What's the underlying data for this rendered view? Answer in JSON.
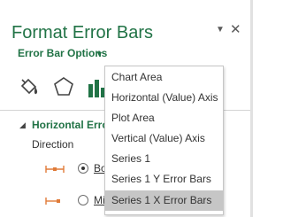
{
  "pane": {
    "title": "Format Error Bars",
    "options_label": "Error Bar Options"
  },
  "icons": {
    "pin_dropdown": "▼",
    "close": "✕",
    "options_dropdown": "▼",
    "fill": "fill-line-icon",
    "effects": "effects-pentagon-icon",
    "options": "bar-chart-options-icon"
  },
  "section": {
    "expander": "◢",
    "heading": "Horizontal Erro",
    "direction_label": "Direction",
    "radios": [
      {
        "label": "Bo",
        "checked": true
      },
      {
        "label": "Mi",
        "checked": false
      }
    ]
  },
  "dropdown": {
    "items": [
      {
        "label": "Chart Area",
        "selected": false
      },
      {
        "label": "Horizontal (Value) Axis",
        "selected": false
      },
      {
        "label": "Plot Area",
        "selected": false
      },
      {
        "label": "Vertical (Value) Axis",
        "selected": false
      },
      {
        "label": "Series 1",
        "selected": false
      },
      {
        "label": "Series 1 Y Error Bars",
        "selected": false
      },
      {
        "label": "Series 1 X Error Bars",
        "selected": true
      }
    ]
  },
  "colors": {
    "accent_green": "#217346",
    "icon_orange": "#e07b39",
    "selected_item_bg": "#c6c6c6"
  }
}
